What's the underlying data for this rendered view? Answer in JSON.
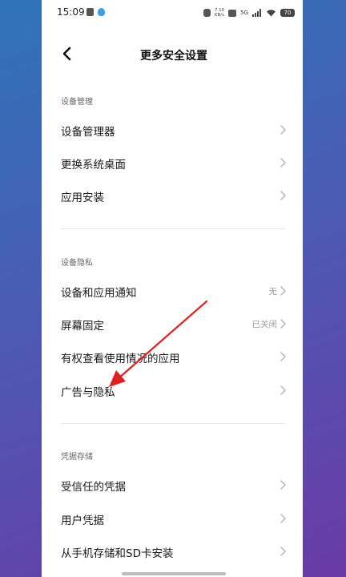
{
  "status_bar": {
    "time": "15:09",
    "network": "5G",
    "speed_value": "7.10",
    "speed_unit": "KB/s",
    "battery": "70"
  },
  "header": {
    "back_icon": "chevron-left-icon",
    "title": "更多安全设置"
  },
  "sections": [
    {
      "title": "设备管理",
      "items": [
        {
          "label": "设备管理器",
          "value": ""
        },
        {
          "label": "更换系统桌面",
          "value": ""
        },
        {
          "label": "应用安装",
          "value": ""
        }
      ]
    },
    {
      "title": "设备隐私",
      "items": [
        {
          "label": "设备和应用通知",
          "value": "无"
        },
        {
          "label": "屏幕固定",
          "value": "已关闭"
        },
        {
          "label": "有权查看使用情况的应用",
          "value": ""
        },
        {
          "label": "广告与隐私",
          "value": ""
        }
      ]
    },
    {
      "title": "凭据存储",
      "items": [
        {
          "label": "受信任的凭据",
          "value": ""
        },
        {
          "label": "用户凭据",
          "value": ""
        },
        {
          "label": "从手机存储和SD卡安装",
          "value": ""
        }
      ]
    }
  ],
  "colors": {
    "background_gradient_start": "#2f73b8",
    "background_gradient_end": "#6a3aa6",
    "annotation_arrow": "#e02020"
  }
}
